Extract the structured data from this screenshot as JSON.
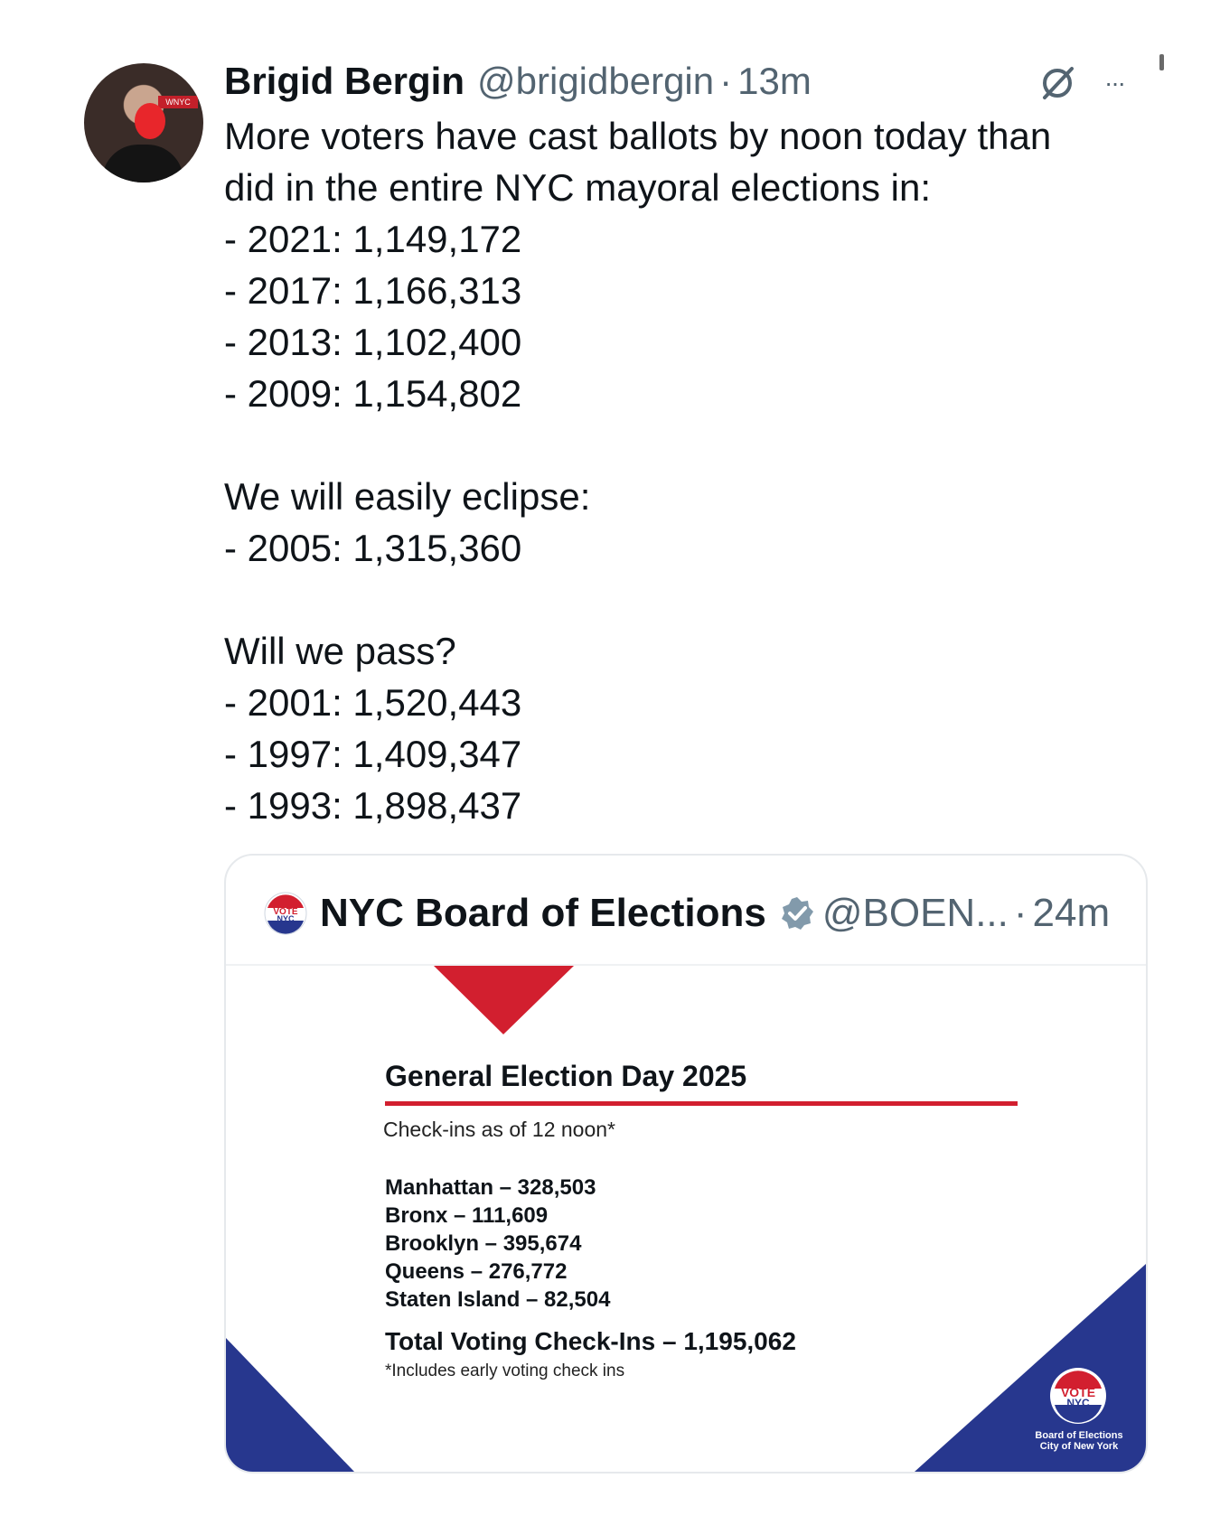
{
  "tweet": {
    "author_name": "Brigid Bergin",
    "handle": "@brigidbergin",
    "separator": "·",
    "time": "13m",
    "lines": [
      "More voters have cast ballots by noon today than",
      "did in the entire NYC mayoral elections in:",
      "- 2021: 1,149,172",
      "- 2017: 1,166,313",
      "- 2013: 1,102,400",
      "- 2009: 1,154,802",
      "",
      "We will easily eclipse:",
      "- 2005: 1,315,360",
      "",
      "Will we pass?",
      "- 2001: 1,520,443",
      "- 1997: 1,409,347",
      "- 1993: 1,898,437"
    ],
    "avatar_sign_text": "WNYC",
    "more_icon": "···",
    "grok_icon": "grok-icon"
  },
  "quote": {
    "author_name": "NYC Board of Elections",
    "verified_icon": "verified-badge-icon",
    "handle": "@BOEN...",
    "separator": "·",
    "time": "24m",
    "logo_text_top": "VOTE",
    "logo_text_bottom": "NYC"
  },
  "graphic": {
    "title": "General Election Day 2025",
    "subtitle": "Check-ins as of 12 noon*",
    "boroughs": [
      "Manhattan – 328,503",
      "Bronx – 111,609",
      "Brooklyn – 395,674",
      "Queens – 276,772",
      "Staten Island – 82,504"
    ],
    "total": "Total Voting Check-Ins – 1,195,062",
    "footnote": "*Includes early voting check ins",
    "badge_top": "VOTE",
    "badge_bottom": "NYC",
    "caption_line1": "Board of Elections",
    "caption_line2": "City of New York",
    "colors": {
      "red": "#d21f2f",
      "blue": "#27378e"
    }
  }
}
